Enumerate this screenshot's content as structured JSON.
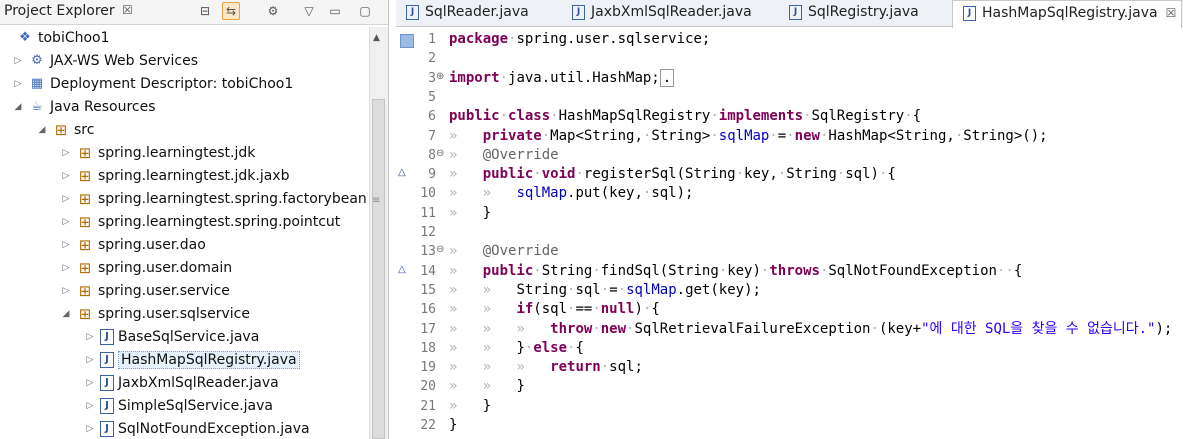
{
  "explorer": {
    "title": "Project Explorer",
    "close": "☒",
    "toolbar": [
      "⊟",
      "⇆",
      "⚙",
      "▽",
      "▭",
      "▢"
    ],
    "items": [
      {
        "label": "tobiChoo1",
        "twisty": "",
        "icon": "project-icon"
      },
      {
        "label": "JAX-WS Web Services",
        "twisty": "▷",
        "icon": "webservice-icon"
      },
      {
        "label": "Deployment Descriptor: tobiChoo1",
        "twisty": "▷",
        "icon": "descriptor-icon"
      },
      {
        "label": "Java Resources",
        "twisty": "◢",
        "icon": "java-resources-icon"
      },
      {
        "label": "src",
        "twisty": "◢",
        "icon": "source-folder-icon"
      },
      {
        "label": "spring.learningtest.jdk",
        "twisty": "▷",
        "icon": "package-icon"
      },
      {
        "label": "spring.learningtest.jdk.jaxb",
        "twisty": "▷",
        "icon": "package-icon"
      },
      {
        "label": "spring.learningtest.spring.factorybean",
        "twisty": "▷",
        "icon": "package-icon"
      },
      {
        "label": "spring.learningtest.spring.pointcut",
        "twisty": "▷",
        "icon": "package-icon"
      },
      {
        "label": "spring.user.dao",
        "twisty": "▷",
        "icon": "package-icon"
      },
      {
        "label": "spring.user.domain",
        "twisty": "▷",
        "icon": "package-icon"
      },
      {
        "label": "spring.user.service",
        "twisty": "▷",
        "icon": "package-icon"
      },
      {
        "label": "spring.user.sqlservice",
        "twisty": "◢",
        "icon": "package-icon"
      },
      {
        "label": "BaseSqlService.java",
        "twisty": "▷",
        "icon": "java-file-icon"
      },
      {
        "label": "HashMapSqlRegistry.java",
        "twisty": "▷",
        "icon": "java-file-icon",
        "selected": true
      },
      {
        "label": "JaxbXmlSqlReader.java",
        "twisty": "▷",
        "icon": "java-file-icon"
      },
      {
        "label": "SimpleSqlService.java",
        "twisty": "▷",
        "icon": "java-file-icon"
      },
      {
        "label": "SqlNotFoundException.java",
        "twisty": "▷",
        "icon": "java-file-icon"
      }
    ]
  },
  "editor": {
    "tabs": [
      {
        "label": "SqlReader.java",
        "active": false
      },
      {
        "label": "JaxbXmlSqlReader.java",
        "active": false
      },
      {
        "label": "SqlRegistry.java",
        "active": false
      },
      {
        "label": "HashMapSqlRegistry.java",
        "active": true,
        "close": "☒"
      }
    ],
    "lines": [
      {
        "n": "1",
        "segs": [
          [
            "kw",
            "package"
          ],
          [
            "ws",
            "·"
          ],
          [
            "",
            "spring.user.sqlservice;"
          ]
        ]
      },
      {
        "n": "2",
        "segs": []
      },
      {
        "n": "3",
        "fold": "⊕",
        "segs": [
          [
            "kw",
            "import"
          ],
          [
            "ws",
            "·"
          ],
          [
            "",
            "java.util.HashMap;"
          ],
          [
            "box",
            "."
          ]
        ]
      },
      {
        "n": "5",
        "segs": []
      },
      {
        "n": "6",
        "segs": [
          [
            "kw",
            "public"
          ],
          [
            "ws",
            "·"
          ],
          [
            "kw",
            "class"
          ],
          [
            "ws",
            "·"
          ],
          [
            "",
            "HashMapSqlRegistry"
          ],
          [
            "ws",
            "·"
          ],
          [
            "kw",
            "implements"
          ],
          [
            "ws",
            "·"
          ],
          [
            "",
            "SqlRegistry"
          ],
          [
            "ws",
            "·"
          ],
          [
            "",
            "{"
          ]
        ]
      },
      {
        "n": "7",
        "segs": [
          [
            "ws",
            "»   "
          ],
          [
            "kw",
            "private"
          ],
          [
            "ws",
            "·"
          ],
          [
            "",
            "Map<String,"
          ],
          [
            "ws",
            "·"
          ],
          [
            "",
            "String>"
          ],
          [
            "ws",
            "·"
          ],
          [
            "fld",
            "sqlMap"
          ],
          [
            "ws",
            "·"
          ],
          [
            "",
            "="
          ],
          [
            "ws",
            "·"
          ],
          [
            "kw",
            "new"
          ],
          [
            "ws",
            "·"
          ],
          [
            "",
            "HashMap<String,"
          ],
          [
            "ws",
            "·"
          ],
          [
            "",
            "String>();"
          ]
        ]
      },
      {
        "n": "8",
        "fold": "⊖",
        "segs": [
          [
            "ws",
            "»   "
          ],
          [
            "ann",
            "@Override"
          ]
        ]
      },
      {
        "n": "9",
        "mark": "△",
        "segs": [
          [
            "ws",
            "»   "
          ],
          [
            "kw",
            "public"
          ],
          [
            "ws",
            "·"
          ],
          [
            "kw",
            "void"
          ],
          [
            "ws",
            "·"
          ],
          [
            "",
            "registerSql(String"
          ],
          [
            "ws",
            "·"
          ],
          [
            "",
            "key,"
          ],
          [
            "ws",
            "·"
          ],
          [
            "",
            "String"
          ],
          [
            "ws",
            "·"
          ],
          [
            "",
            "sql)"
          ],
          [
            "ws",
            "·"
          ],
          [
            "",
            "{"
          ]
        ]
      },
      {
        "n": "10",
        "segs": [
          [
            "ws",
            "»   »   "
          ],
          [
            "fld",
            "sqlMap"
          ],
          [
            "",
            ".put(key,"
          ],
          [
            "ws",
            "·"
          ],
          [
            "",
            "sql);"
          ]
        ]
      },
      {
        "n": "11",
        "segs": [
          [
            "ws",
            "»   "
          ],
          [
            "",
            "}"
          ]
        ]
      },
      {
        "n": "12",
        "segs": []
      },
      {
        "n": "13",
        "fold": "⊖",
        "segs": [
          [
            "ws",
            "»   "
          ],
          [
            "ann",
            "@Override"
          ]
        ]
      },
      {
        "n": "14",
        "mark": "△",
        "segs": [
          [
            "ws",
            "»   "
          ],
          [
            "kw",
            "public"
          ],
          [
            "ws",
            "·"
          ],
          [
            "",
            "String"
          ],
          [
            "ws",
            "·"
          ],
          [
            "",
            "findSql(String"
          ],
          [
            "ws",
            "·"
          ],
          [
            "",
            "key)"
          ],
          [
            "ws",
            "·"
          ],
          [
            "kw",
            "throws"
          ],
          [
            "ws",
            "·"
          ],
          [
            "",
            "SqlNotFoundException"
          ],
          [
            "ws",
            "··"
          ],
          [
            "",
            "{"
          ]
        ]
      },
      {
        "n": "15",
        "segs": [
          [
            "ws",
            "»   »   "
          ],
          [
            "",
            "String"
          ],
          [
            "ws",
            "·"
          ],
          [
            "",
            "sql"
          ],
          [
            "ws",
            "·"
          ],
          [
            "",
            "="
          ],
          [
            "ws",
            "·"
          ],
          [
            "fld",
            "sqlMap"
          ],
          [
            "",
            ".get(key);"
          ]
        ]
      },
      {
        "n": "16",
        "segs": [
          [
            "ws",
            "»   »   "
          ],
          [
            "kw",
            "if"
          ],
          [
            "",
            "(sql"
          ],
          [
            "ws",
            "·"
          ],
          [
            "",
            "=="
          ],
          [
            "ws",
            "·"
          ],
          [
            "kw",
            "null"
          ],
          [
            "",
            ")"
          ],
          [
            "ws",
            "·"
          ],
          [
            "",
            "{"
          ]
        ]
      },
      {
        "n": "17",
        "segs": [
          [
            "ws",
            "»   »   »   "
          ],
          [
            "kw",
            "throw"
          ],
          [
            "ws",
            "·"
          ],
          [
            "kw",
            "new"
          ],
          [
            "ws",
            "·"
          ],
          [
            "",
            "SqlRetrievalFailureException"
          ],
          [
            "ws",
            "·"
          ],
          [
            "",
            "(key+"
          ],
          [
            "str",
            "\"에 대한 SQL을 찾을 수 없습니다.\""
          ],
          [
            "",
            ");"
          ]
        ]
      },
      {
        "n": "18",
        "segs": [
          [
            "ws",
            "»   »   "
          ],
          [
            "",
            "}"
          ],
          [
            "ws",
            "·"
          ],
          [
            "kw",
            "else"
          ],
          [
            "ws",
            "·"
          ],
          [
            "",
            "{"
          ]
        ]
      },
      {
        "n": "19",
        "segs": [
          [
            "ws",
            "»   »   »   "
          ],
          [
            "kw",
            "return"
          ],
          [
            "ws",
            "·"
          ],
          [
            "",
            "sql;"
          ]
        ]
      },
      {
        "n": "20",
        "segs": [
          [
            "ws",
            "»   »   "
          ],
          [
            "",
            "}"
          ]
        ]
      },
      {
        "n": "21",
        "segs": [
          [
            "ws",
            "»   "
          ],
          [
            "",
            "}"
          ]
        ]
      },
      {
        "n": "22",
        "segs": [
          [
            "",
            "}"
          ]
        ]
      }
    ]
  },
  "colors": {
    "keyword": "#7f0055",
    "field": "#0000c0",
    "string": "#2a00ff",
    "annotation": "#646464"
  }
}
